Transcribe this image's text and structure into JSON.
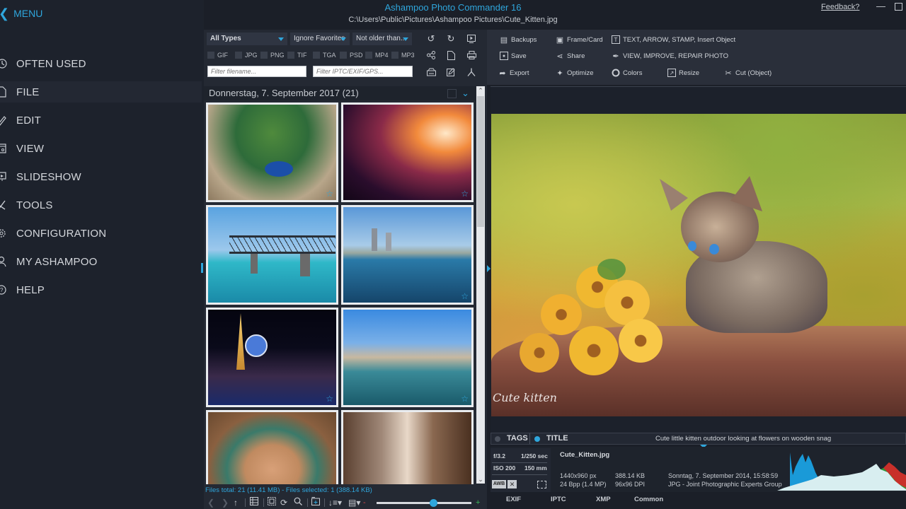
{
  "window": {
    "app_title": "Ashampoo Photo Commander 16",
    "file_path": "C:\\Users\\Public\\Pictures\\Ashampoo Pictures\\Cute_Kitten.jpg",
    "feedback_label": "Feedback?",
    "minimize_label": "—"
  },
  "sidebar": {
    "back_label": "MENU",
    "items": [
      {
        "label": "OFTEN USED",
        "icon": "clock-icon"
      },
      {
        "label": "FILE",
        "icon": "file-icon"
      },
      {
        "label": "EDIT",
        "icon": "pencil-icon"
      },
      {
        "label": "VIEW",
        "icon": "view-icon"
      },
      {
        "label": "SLIDESHOW",
        "icon": "slideshow-icon"
      },
      {
        "label": "TOOLS",
        "icon": "tools-icon"
      },
      {
        "label": "CONFIGURATION",
        "icon": "gear-icon"
      },
      {
        "label": "MY ASHAMPOO",
        "icon": "user-icon"
      },
      {
        "label": "HELP",
        "icon": "help-icon"
      }
    ],
    "active_item": "FILE"
  },
  "browser": {
    "type_filter": "All Types",
    "favorites_filter": "Ignore Favorites",
    "age_filter": "Not older than...",
    "extensions": [
      "GIF",
      "JPG",
      "PNG",
      "TIF",
      "TGA",
      "PSD",
      "MP4",
      "MP3"
    ],
    "filename_placeholder": "Filter filename...",
    "metadata_placeholder": "Filter IPTC/EXIF/GPS...",
    "group_title": "Donnerstag, 7. September 2017 (21)",
    "thumbnails": [
      {
        "subject": "Peacock",
        "favorite_star": true
      },
      {
        "subject": "Antelope Canyon",
        "favorite_star": true
      },
      {
        "subject": "Bahia Honda Rail Bridge",
        "favorite_star": false
      },
      {
        "subject": "Miami Beach",
        "favorite_star": true
      },
      {
        "subject": "Las Vegas Strip",
        "favorite_star": true
      },
      {
        "subject": "Grand Canal",
        "favorite_star": true
      },
      {
        "subject": "Horseshoe Bend",
        "favorite_star": false
      },
      {
        "subject": "Street market",
        "favorite_star": false
      }
    ],
    "status": "Files total: 21 (11.41 MB) - Files selected: 1 (388.14 KB)",
    "thumb_zoom_level": 0.6,
    "zoom_minus": "-",
    "zoom_plus": "+"
  },
  "ribbon": {
    "rows": [
      [
        {
          "label": "Backups",
          "icon": "backup-icon"
        },
        {
          "label": "Frame/Card",
          "icon": "frame-icon"
        },
        {
          "label": "TEXT, ARROW, STAMP, Insert Object",
          "icon": "text-icon"
        }
      ],
      [
        {
          "label": "Save",
          "icon": "save-icon"
        },
        {
          "label": "Share",
          "icon": "share-icon"
        },
        {
          "label": "VIEW, IMPROVE, REPAIR PHOTO",
          "icon": "brush-icon"
        }
      ],
      [
        {
          "label": "Export",
          "icon": "export-icon"
        },
        {
          "label": "Optimize",
          "icon": "magic-wand-icon"
        },
        {
          "label": "Colors",
          "icon": "colors-icon"
        },
        {
          "label": "Resize",
          "icon": "resize-icon"
        },
        {
          "label": "Cut (Object)",
          "icon": "scissors-icon"
        }
      ]
    ]
  },
  "preview": {
    "watermark": "Cute kitten",
    "viewer_zoom_level": 0.45
  },
  "tagbar": {
    "tags_label": "TAGS",
    "title_label": "TITLE",
    "title_value": "Cute little kitten outdoor looking at flowers on wooden snag"
  },
  "info": {
    "aperture": "f/3.2",
    "shutter": "1/250 sec",
    "iso": "ISO 200",
    "focal": "150 mm",
    "awb": "AWB",
    "filename": "Cute_Kitten.jpg",
    "dimensions": "1440x960 px",
    "bit_depth": "24 Bpp (1.4 MP)",
    "file_size": "388.14 KB",
    "dpi": "96x96 DPI",
    "date": "Sonntag, 7. September 2014, 15:58:59",
    "format": "JPG - Joint Photographic Experts Group"
  },
  "meta_tabs": [
    "EXIF",
    "IPTC",
    "XMP",
    "Common"
  ],
  "colors": {
    "accent": "#2fa6dc",
    "background": "#1b1f28",
    "panel": "#242933",
    "ribbon": "#2a2f3a"
  }
}
